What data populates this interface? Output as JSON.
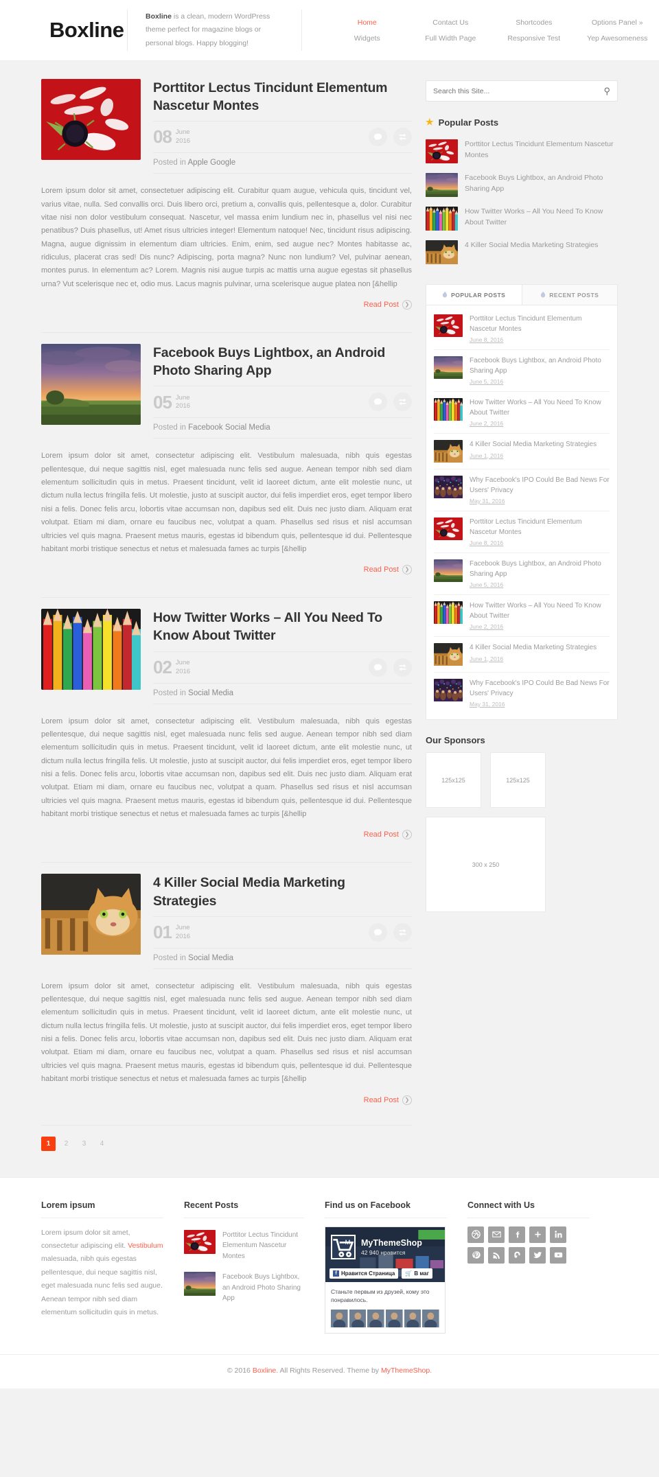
{
  "header": {
    "logo": "Boxline",
    "tagline_brand": "Boxline",
    "tagline_rest": " is a clean, modern WordPress theme perfect for magazine blogs or personal blogs. Happy blogging!",
    "nav": [
      {
        "label": "Home",
        "active": true
      },
      {
        "label": "Contact Us",
        "active": false
      },
      {
        "label": "Shortcodes",
        "active": false
      },
      {
        "label": "Options Panel »",
        "active": false
      },
      {
        "label": "Widgets",
        "active": false
      },
      {
        "label": "Full Width Page",
        "active": false
      },
      {
        "label": "Responsive Test",
        "active": false
      },
      {
        "label": "Yep Awesomeness",
        "active": false
      }
    ]
  },
  "posts": [
    {
      "title": "Porttitor Lectus Tincidunt Elementum Nascetur Montes",
      "day": "08",
      "month": "June",
      "year": "2016",
      "posted_label": "Posted in ",
      "category": "Apple Google",
      "thumb": "red-petals",
      "excerpt": "Lorem ipsum dolor sit amet, consectetuer adipiscing elit. Curabitur quam augue, vehicula quis, tincidunt vel, varius vitae, nulla. Sed convallis orci. Duis libero orci, pretium a, convallis quis, pellentesque a, dolor. Curabitur vitae nisi non dolor vestibulum consequat. Nascetur, vel massa enim lundium nec in, phasellus vel nisi nec penatibus? Duis phasellus, ut! Amet risus ultricies integer! Elementum natoque! Nec, tincidunt risus adipiscing. Magna, augue dignissim in elementum diam ultricies. Enim, enim, sed augue nec? Montes habitasse ac, ridiculus, placerat cras sed! Dis nunc? Adipiscing, porta magna? Nunc non lundium? Vel, pulvinar aenean, montes purus. In elementum ac? Lorem. Magnis nisi augue turpis ac mattis urna augue egestas sit phasellus urna? Vut scelerisque nec et, odio mus. Lacus magnis pulvinar, urna scelerisque augue platea non [&hellip",
      "read_more": "Read Post"
    },
    {
      "title": "Facebook Buys Lightbox, an Android Photo Sharing App",
      "day": "05",
      "month": "June",
      "year": "2016",
      "posted_label": "Posted in ",
      "category": "Facebook Social Media",
      "thumb": "sunset-field",
      "excerpt": "Lorem ipsum dolor sit amet, consectetur adipiscing elit. Vestibulum malesuada, nibh quis egestas pellentesque, dui neque sagittis nisl, eget malesuada nunc felis sed augue. Aenean tempor nibh sed diam elementum sollicitudin quis in metus. Praesent tincidunt, velit id laoreet dictum, ante elit molestie nunc, ut dictum nulla lectus fringilla felis. Ut molestie, justo at suscipit auctor, dui felis imperdiet eros, eget tempor libero nisi a felis. Donec felis arcu, lobortis vitae accumsan non, dapibus sed elit. Duis nec justo diam. Aliquam erat volutpat. Etiam mi diam, ornare eu faucibus nec, volutpat a quam. Phasellus sed risus et nisl accumsan ultricies vel quis magna. Praesent metus mauris, egestas id bibendum quis, pellentesque id dui. Pellentesque habitant morbi tristique senectus et netus et malesuada fames ac turpis [&hellip",
      "read_more": "Read Post"
    },
    {
      "title": "How Twitter Works – All You Need To Know About Twitter",
      "day": "02",
      "month": "June",
      "year": "2016",
      "posted_label": "Posted in ",
      "category": "Social Media",
      "thumb": "pencils",
      "excerpt": "Lorem ipsum dolor sit amet, consectetur adipiscing elit. Vestibulum malesuada, nibh quis egestas pellentesque, dui neque sagittis nisl, eget malesuada nunc felis sed augue. Aenean tempor nibh sed diam elementum sollicitudin quis in metus. Praesent tincidunt, velit id laoreet dictum, ante elit molestie nunc, ut dictum nulla lectus fringilla felis. Ut molestie, justo at suscipit auctor, dui felis imperdiet eros, eget tempor libero nisi a felis. Donec felis arcu, lobortis vitae accumsan non, dapibus sed elit. Duis nec justo diam. Aliquam erat volutpat. Etiam mi diam, ornare eu faucibus nec, volutpat a quam. Phasellus sed risus et nisl accumsan ultricies vel quis magna. Praesent metus mauris, egestas id bibendum quis, pellentesque id dui. Pellentesque habitant morbi tristique senectus et netus et malesuada fames ac turpis [&hellip",
      "read_more": "Read Post"
    },
    {
      "title": "4 Killer Social Media Marketing Strategies",
      "day": "01",
      "month": "June",
      "year": "2016",
      "posted_label": "Posted in ",
      "category": "Social Media",
      "thumb": "tiger-cat",
      "excerpt": "Lorem ipsum dolor sit amet, consectetur adipiscing elit. Vestibulum malesuada, nibh quis egestas pellentesque, dui neque sagittis nisl, eget malesuada nunc felis sed augue. Aenean tempor nibh sed diam elementum sollicitudin quis in metus. Praesent tincidunt, velit id laoreet dictum, ante elit molestie nunc, ut dictum nulla lectus fringilla felis. Ut molestie, justo at suscipit auctor, dui felis imperdiet eros, eget tempor libero nisi a felis. Donec felis arcu, lobortis vitae accumsan non, dapibus sed elit. Duis nec justo diam. Aliquam erat volutpat. Etiam mi diam, ornare eu faucibus nec, volutpat a quam. Phasellus sed risus et nisl accumsan ultricies vel quis magna. Praesent metus mauris, egestas id bibendum quis, pellentesque id dui. Pellentesque habitant morbi tristique senectus et netus et malesuada fames ac turpis [&hellip",
      "read_more": "Read Post"
    }
  ],
  "pagination": {
    "pages": [
      "1",
      "2",
      "3",
      "4"
    ],
    "current": "1"
  },
  "sidebar": {
    "search_placeholder": "Search this Site...",
    "popular_title": "Popular Posts",
    "popular_posts": [
      {
        "title": "Porttitor Lectus Tincidunt Elementum Nascetur Montes",
        "thumb": "red-petals"
      },
      {
        "title": "Facebook Buys Lightbox, an Android Photo Sharing App",
        "thumb": "sunset-field"
      },
      {
        "title": "How Twitter Works – All You Need To Know About Twitter",
        "thumb": "pencils"
      },
      {
        "title": "4 Killer Social Media Marketing Strategies",
        "thumb": "tiger-cat"
      }
    ],
    "tabs": [
      {
        "label": "POPULAR POSTS",
        "active": true
      },
      {
        "label": "RECENT POSTS",
        "active": false
      }
    ],
    "tab_items": [
      {
        "title": "Porttitor Lectus Tincidunt Elementum Nascetur Montes",
        "date": "June 8, 2016",
        "thumb": "red-petals"
      },
      {
        "title": "Facebook Buys Lightbox, an Android Photo Sharing App",
        "date": "June 5, 2016",
        "thumb": "sunset-field"
      },
      {
        "title": "How Twitter Works – All You Need To Know About Twitter",
        "date": "June 2, 2016",
        "thumb": "pencils"
      },
      {
        "title": "4 Killer Social Media Marketing Strategies",
        "date": "June 1, 2016",
        "thumb": "tiger-cat"
      },
      {
        "title": "Why Facebook's IPO Could Be Bad News For Users' Privacy",
        "date": "May 31, 2016",
        "thumb": "crowd"
      },
      {
        "title": "Porttitor Lectus Tincidunt Elementum Nascetur Montes",
        "date": "June 8, 2016",
        "thumb": "red-petals"
      },
      {
        "title": "Facebook Buys Lightbox, an Android Photo Sharing App",
        "date": "June 5, 2016",
        "thumb": "sunset-field"
      },
      {
        "title": "How Twitter Works – All You Need To Know About Twitter",
        "date": "June 2, 2016",
        "thumb": "pencils"
      },
      {
        "title": "4 Killer Social Media Marketing Strategies",
        "date": "June 1, 2016",
        "thumb": "tiger-cat"
      },
      {
        "title": "Why Facebook's IPO Could Be Bad News For Users' Privacy",
        "date": "May 31, 2016",
        "thumb": "crowd"
      }
    ],
    "sponsors_title": "Our Sponsors",
    "sponsor_125_a": "125x125",
    "sponsor_125_b": "125x125",
    "sponsor_300": "300 x 250"
  },
  "footer": {
    "col1_title": "Lorem ipsum",
    "col1_text_a": "Lorem ipsum dolor sit amet, consectetur adipiscing elit. ",
    "col1_link": "Vestibulum",
    "col1_text_b": " malesuada, nibh quis egestas pellentesque, dui neque sagittis nisl, eget malesuada nunc felis sed augue. Aenean tempor nibh sed diam elementum sollicitudin quis in metus.",
    "col2_title": "Recent Posts",
    "recent_posts": [
      {
        "title": "Porttitor Lectus Tincidunt Elementum Nascetur Montes",
        "thumb": "red-petals"
      },
      {
        "title": "Facebook Buys Lightbox, an Android Photo Sharing App",
        "thumb": "sunset-field"
      }
    ],
    "col3_title": "Find us on Facebook",
    "fb_page_name": "MyThemeShop",
    "fb_likes": "42 940 нравится",
    "fb_like_btn": "Нравится Страница",
    "fb_shop_btn": "В маг",
    "fb_message": "Станьте первым из друзей, кому это понравилось.",
    "col4_title": "Connect with Us",
    "socials": [
      "dribbble-icon",
      "email-icon",
      "facebook-icon",
      "google-plus-icon",
      "linkedin-icon",
      "pinterest-icon",
      "rss-icon",
      "stumbleupon-icon",
      "twitter-icon",
      "youtube-icon"
    ]
  },
  "copyright": {
    "prefix": "© 2016 ",
    "brand": "Boxline",
    "middle": ". All Rights Reserved. Theme by ",
    "theme": "MyThemeShop",
    "suffix": "."
  },
  "colors": {
    "accent": "#fc5f4b",
    "pagination_active": "#f93f10",
    "star": "#f5b61a"
  }
}
